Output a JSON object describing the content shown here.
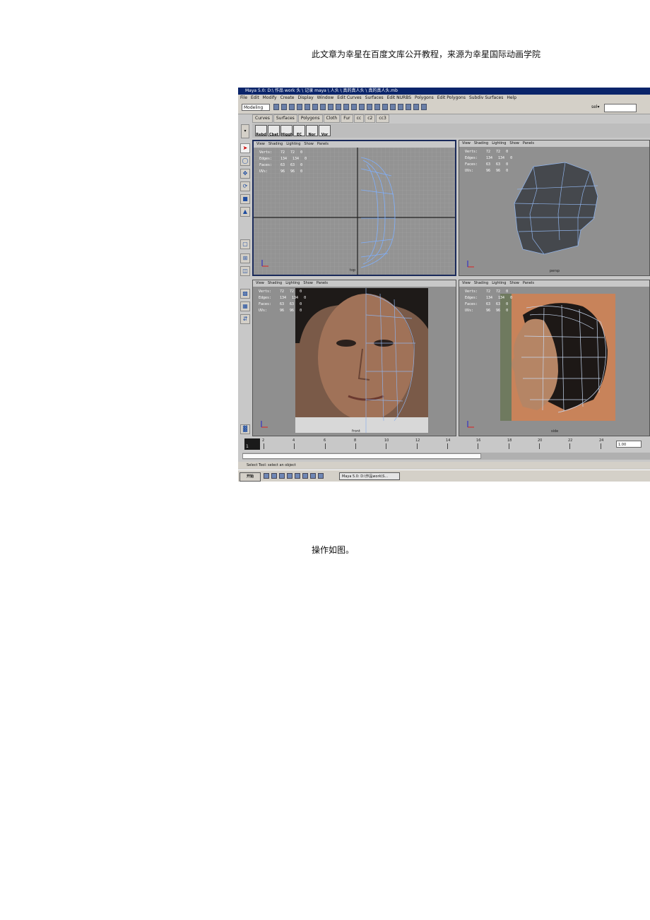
{
  "page": {
    "header": "此文章为幸星在百度文库公开教程，来源为幸星国际动画学院",
    "caption": "操作如图。"
  },
  "maya": {
    "title": "Maya 5.0: D:\\ 作品 work 头 \\ 记录 maya \\ 人头 \\ 真的真人头 \\ 真的真人头.mb",
    "menu": [
      "File",
      "Edit",
      "Modify",
      "Create",
      "Display",
      "Window",
      "Edit Curves",
      "Surfaces",
      "Edit NURBS",
      "Polygons",
      "Edit Polygons",
      "Subdiv Surfaces",
      "Help"
    ],
    "mode": "Modeling",
    "sel_label": "sel▾",
    "shelf_tabs": [
      "Curves",
      "Surfaces",
      "Polygons",
      "Cloth",
      "Fur",
      "cc",
      "c2",
      "cc3"
    ],
    "shelf_buttons": [
      "Rebd",
      "Cbat",
      "Higgh",
      "EC",
      "Nor",
      "Vor"
    ],
    "viewport_menu": [
      "View",
      "Shading",
      "Lighting",
      "Show",
      "Panels"
    ],
    "hud_labels": [
      "Verts:",
      "Edges:",
      "Faces:",
      "UVs:"
    ],
    "hud_values": [
      [
        "72",
        "72",
        "0"
      ],
      [
        "134",
        "134",
        "0"
      ],
      [
        "63",
        "63",
        "0"
      ],
      [
        "96",
        "96",
        "0"
      ]
    ],
    "cameras": {
      "top": "top",
      "persp": "persp",
      "front": "front",
      "side": "side"
    },
    "timeline": {
      "current": "1",
      "ticks": [
        "2",
        "4",
        "6",
        "8",
        "10",
        "12",
        "14",
        "16",
        "18",
        "20",
        "22",
        "24"
      ],
      "field": "1.00"
    },
    "help_line": "Select Tool: select an object",
    "taskbar": {
      "start": "开始",
      "task": "Maya 5.0: D:\\作品work\\S..."
    }
  }
}
